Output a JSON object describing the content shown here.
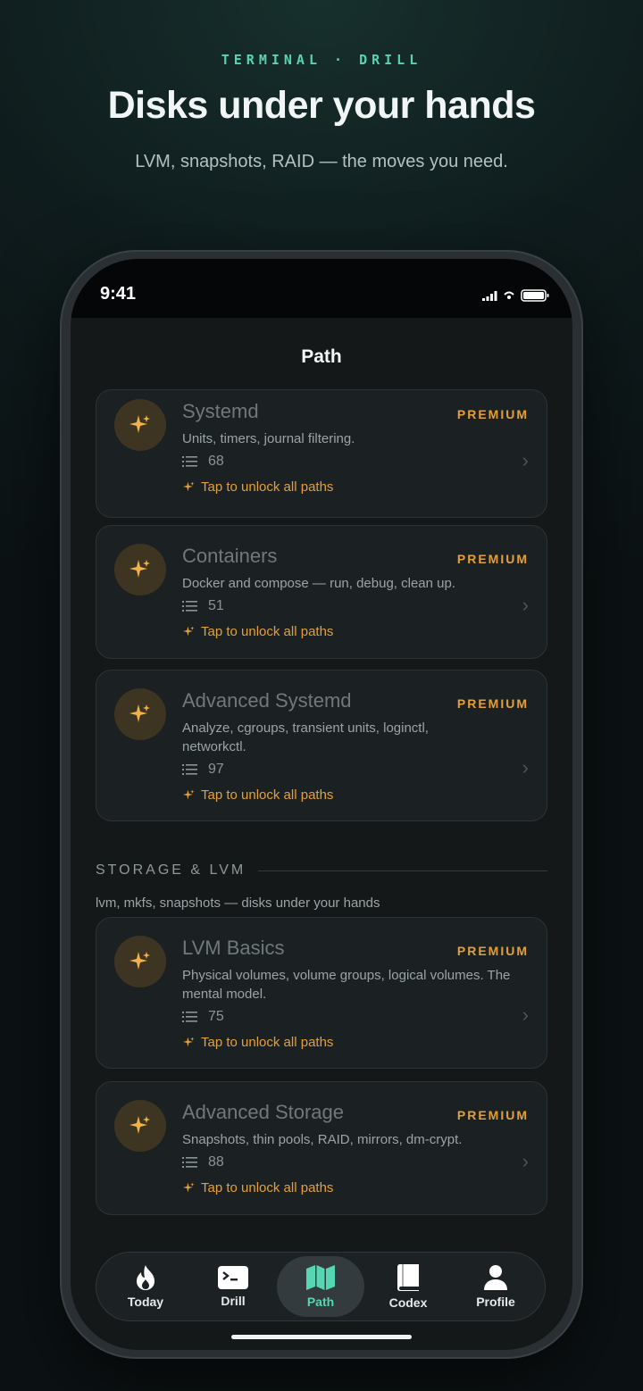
{
  "promo": {
    "eyebrow": "TERMINAL · DRILL",
    "headline": "Disks under your hands",
    "subhead": "LVM, snapshots, RAID — the moves you need."
  },
  "status_bar": {
    "time": "9:41"
  },
  "nav": {
    "title": "Path"
  },
  "cards": [
    {
      "title": "Systemd",
      "badge": "PREMIUM",
      "description": "Units, timers, journal filtering.",
      "count": "68",
      "unlock": "Tap to unlock all paths"
    },
    {
      "title": "Containers",
      "badge": "PREMIUM",
      "description": "Docker and compose — run, debug, clean up.",
      "count": "51",
      "unlock": "Tap to unlock all paths"
    },
    {
      "title": "Advanced Systemd",
      "badge": "PREMIUM",
      "description": "Analyze, cgroups, transient units, loginctl, networkctl.",
      "count": "97",
      "unlock": "Tap to unlock all paths"
    },
    {
      "title": "LVM Basics",
      "badge": "PREMIUM",
      "description": "Physical volumes, volume groups, logical volumes. The mental model.",
      "count": "75",
      "unlock": "Tap to unlock all paths"
    },
    {
      "title": "Advanced Storage",
      "badge": "PREMIUM",
      "description": "Snapshots, thin pools, RAID, mirrors, dm-crypt.",
      "count": "88",
      "unlock": "Tap to unlock all paths"
    }
  ],
  "section": {
    "label": "STORAGE & LVM",
    "subtitle": "lvm, mkfs, snapshots — disks under your hands"
  },
  "tabs": [
    {
      "label": "Today",
      "icon": "flame-icon"
    },
    {
      "label": "Drill",
      "icon": "terminal-icon"
    },
    {
      "label": "Path",
      "icon": "map-icon",
      "active": true
    },
    {
      "label": "Codex",
      "icon": "book-icon"
    },
    {
      "label": "Profile",
      "icon": "person-icon"
    }
  ],
  "colors": {
    "accent": "#54d7b2",
    "premium": "#e3a03a",
    "background": "#0f1c1d",
    "card": "#1b2022"
  }
}
